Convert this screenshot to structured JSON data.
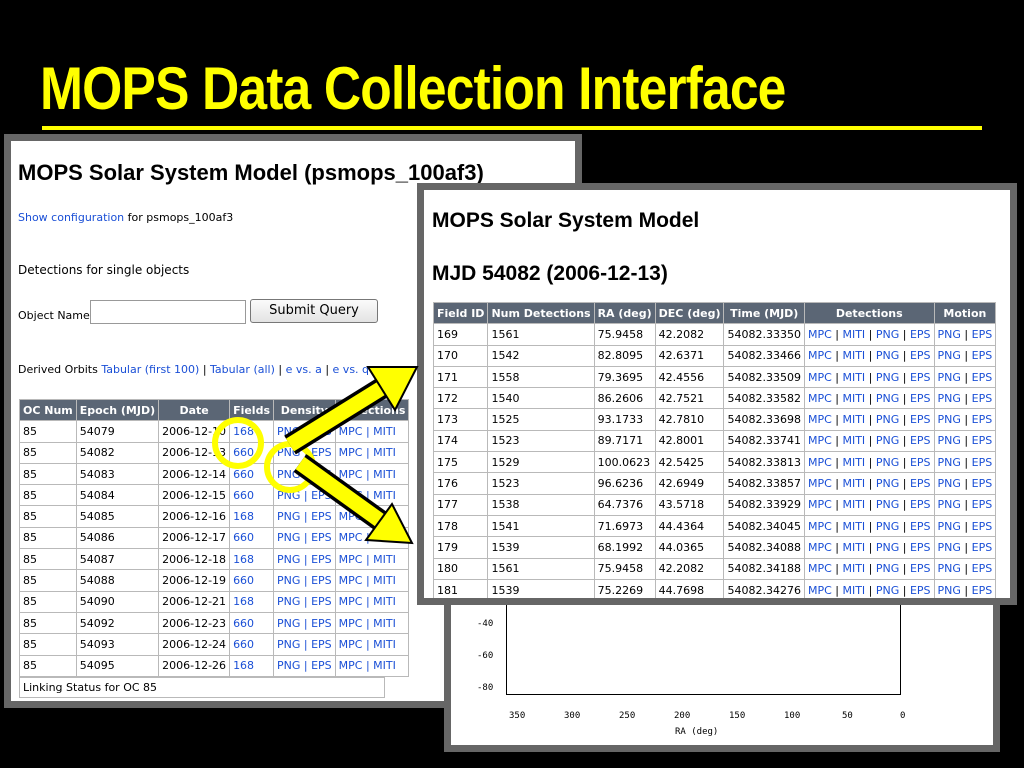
{
  "slide": {
    "title": "MOPS Data Collection Interface"
  },
  "colors": {
    "accent": "#ffff00",
    "link": "#1a4fd6",
    "header": "#5b6675",
    "frame": "#666666"
  },
  "left_page": {
    "heading": "MOPS Solar System Model (psmops_100af3)",
    "show_config_link": "Show configuration",
    "config_suffix": "for psmops_100af3",
    "detections_label": "Detections for single objects",
    "object_label": "Object Name:",
    "object_value": "",
    "submit_label": "Submit Query",
    "orbits_label": "Derived Orbits",
    "orbits_links": [
      "Tabular (first 100)",
      "Tabular (all)",
      "e vs. a",
      "e vs. q"
    ],
    "table": {
      "headers": [
        "OC Num",
        "Epoch (MJD)",
        "Date",
        "Fields",
        "Density",
        "Detections"
      ],
      "rows": [
        [
          "85",
          "54079",
          "2006-12-10",
          "168",
          "PNG | EPS",
          "MPC | MITI"
        ],
        [
          "85",
          "54082",
          "2006-12-13",
          "660",
          "PNG | EPS",
          "MPC | MITI"
        ],
        [
          "85",
          "54083",
          "2006-12-14",
          "660",
          "PNG | EPS",
          "MPC | MITI"
        ],
        [
          "85",
          "54084",
          "2006-12-15",
          "660",
          "PNG | EPS",
          "MPC | MITI"
        ],
        [
          "85",
          "54085",
          "2006-12-16",
          "168",
          "PNG | EPS",
          "MPC | MITI"
        ],
        [
          "85",
          "54086",
          "2006-12-17",
          "660",
          "PNG | EPS",
          "MPC | MITI"
        ],
        [
          "85",
          "54087",
          "2006-12-18",
          "168",
          "PNG | EPS",
          "MPC | MITI"
        ],
        [
          "85",
          "54088",
          "2006-12-19",
          "660",
          "PNG | EPS",
          "MPC | MITI"
        ],
        [
          "85",
          "54090",
          "2006-12-21",
          "168",
          "PNG | EPS",
          "MPC | MITI"
        ],
        [
          "85",
          "54092",
          "2006-12-23",
          "660",
          "PNG | EPS",
          "MPC | MITI"
        ],
        [
          "85",
          "54093",
          "2006-12-24",
          "660",
          "PNG | EPS",
          "MPC | MITI"
        ],
        [
          "85",
          "54095",
          "2006-12-26",
          "168",
          "PNG | EPS",
          "MPC | MITI"
        ]
      ]
    },
    "linking_status": "Linking Status for OC 85"
  },
  "right_page": {
    "heading": "MOPS Solar System Model",
    "subheading": "MJD 54082 (2006-12-13)",
    "table": {
      "headers": [
        "Field ID",
        "Num Detections",
        "RA (deg)",
        "DEC (deg)",
        "Time (MJD)",
        "Detections",
        "Motion"
      ],
      "detections_links": [
        "MPC",
        "MITI",
        "PNG",
        "EPS"
      ],
      "motion_links": [
        "PNG",
        "EPS"
      ],
      "rows": [
        [
          "169",
          "1561",
          "75.9458",
          "42.2082",
          "54082.33350"
        ],
        [
          "170",
          "1542",
          "82.8095",
          "42.6371",
          "54082.33466"
        ],
        [
          "171",
          "1558",
          "79.3695",
          "42.4556",
          "54082.33509"
        ],
        [
          "172",
          "1540",
          "86.2606",
          "42.7521",
          "54082.33582"
        ],
        [
          "173",
          "1525",
          "93.1733",
          "42.7810",
          "54082.33698"
        ],
        [
          "174",
          "1523",
          "89.7171",
          "42.8001",
          "54082.33741"
        ],
        [
          "175",
          "1529",
          "100.0623",
          "42.5425",
          "54082.33813"
        ],
        [
          "176",
          "1523",
          "96.6236",
          "42.6949",
          "54082.33857"
        ],
        [
          "177",
          "1538",
          "64.7376",
          "43.5718",
          "54082.33929"
        ],
        [
          "178",
          "1541",
          "71.6973",
          "44.4364",
          "54082.34045"
        ],
        [
          "179",
          "1539",
          "68.1992",
          "44.0365",
          "54082.34088"
        ],
        [
          "180",
          "1561",
          "75.9458",
          "42.2082",
          "54082.34188"
        ],
        [
          "181",
          "1539",
          "75.2269",
          "44.7698",
          "54082.34276"
        ]
      ]
    }
  },
  "plot": {
    "y_ticks": [
      "-40",
      "-60",
      "-80"
    ],
    "x_ticks": [
      "350",
      "300",
      "250",
      "200",
      "150",
      "100",
      "50",
      "0"
    ],
    "xlabel": "RA (deg)"
  }
}
